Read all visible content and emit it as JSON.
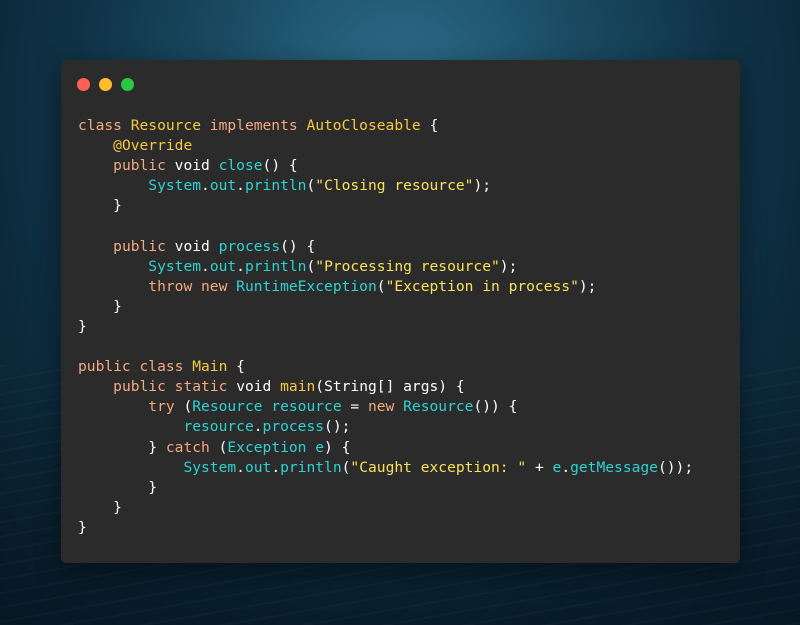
{
  "window": {
    "controls": [
      "close-dot",
      "minimize-dot",
      "maximize-dot"
    ]
  },
  "colors": {
    "keyword": "#f5a97f",
    "type": "#f6c942",
    "identifier": "#2fd3d3",
    "string": "#f9e25b",
    "plain": "#ffffff",
    "editor_bg": "#2b2b2b"
  },
  "code": {
    "language": "Java",
    "lines": [
      [
        {
          "t": "class ",
          "c": "k"
        },
        {
          "t": "Resource ",
          "c": "t"
        },
        {
          "t": "implements ",
          "c": "k"
        },
        {
          "t": "AutoCloseable",
          "c": "t"
        },
        {
          "t": " {",
          "c": "p"
        }
      ],
      [
        {
          "t": "    ",
          "c": "p"
        },
        {
          "t": "@Override",
          "c": "a"
        }
      ],
      [
        {
          "t": "    ",
          "c": "p"
        },
        {
          "t": "public ",
          "c": "k"
        },
        {
          "t": "void ",
          "c": "p"
        },
        {
          "t": "close",
          "c": "f"
        },
        {
          "t": "() {",
          "c": "p"
        }
      ],
      [
        {
          "t": "        ",
          "c": "p"
        },
        {
          "t": "System",
          "c": "f"
        },
        {
          "t": ".",
          "c": "p"
        },
        {
          "t": "out",
          "c": "f"
        },
        {
          "t": ".",
          "c": "p"
        },
        {
          "t": "println",
          "c": "f"
        },
        {
          "t": "(",
          "c": "p"
        },
        {
          "t": "\"Closing resource\"",
          "c": "s"
        },
        {
          "t": ");",
          "c": "p"
        }
      ],
      [
        {
          "t": "    }",
          "c": "p"
        }
      ],
      [],
      [
        {
          "t": "    ",
          "c": "p"
        },
        {
          "t": "public ",
          "c": "k"
        },
        {
          "t": "void ",
          "c": "p"
        },
        {
          "t": "process",
          "c": "f"
        },
        {
          "t": "() {",
          "c": "p"
        }
      ],
      [
        {
          "t": "        ",
          "c": "p"
        },
        {
          "t": "System",
          "c": "f"
        },
        {
          "t": ".",
          "c": "p"
        },
        {
          "t": "out",
          "c": "f"
        },
        {
          "t": ".",
          "c": "p"
        },
        {
          "t": "println",
          "c": "f"
        },
        {
          "t": "(",
          "c": "p"
        },
        {
          "t": "\"Processing resource\"",
          "c": "s"
        },
        {
          "t": ");",
          "c": "p"
        }
      ],
      [
        {
          "t": "        ",
          "c": "p"
        },
        {
          "t": "throw ",
          "c": "k"
        },
        {
          "t": "new ",
          "c": "k"
        },
        {
          "t": "RuntimeException",
          "c": "f"
        },
        {
          "t": "(",
          "c": "p"
        },
        {
          "t": "\"Exception in process\"",
          "c": "s"
        },
        {
          "t": ");",
          "c": "p"
        }
      ],
      [
        {
          "t": "    }",
          "c": "p"
        }
      ],
      [
        {
          "t": "}",
          "c": "p"
        }
      ],
      [],
      [
        {
          "t": "public ",
          "c": "k"
        },
        {
          "t": "class ",
          "c": "k"
        },
        {
          "t": "Main",
          "c": "t"
        },
        {
          "t": " {",
          "c": "p"
        }
      ],
      [
        {
          "t": "    ",
          "c": "p"
        },
        {
          "t": "public ",
          "c": "k"
        },
        {
          "t": "static ",
          "c": "k"
        },
        {
          "t": "void ",
          "c": "p"
        },
        {
          "t": "main",
          "c": "t"
        },
        {
          "t": "(String[] args) {",
          "c": "p"
        }
      ],
      [
        {
          "t": "        ",
          "c": "p"
        },
        {
          "t": "try ",
          "c": "k"
        },
        {
          "t": "(",
          "c": "p"
        },
        {
          "t": "Resource resource",
          "c": "f"
        },
        {
          "t": " = ",
          "c": "p"
        },
        {
          "t": "new ",
          "c": "k"
        },
        {
          "t": "Resource",
          "c": "f"
        },
        {
          "t": "()) {",
          "c": "p"
        }
      ],
      [
        {
          "t": "            ",
          "c": "p"
        },
        {
          "t": "resource",
          "c": "f"
        },
        {
          "t": ".",
          "c": "p"
        },
        {
          "t": "process",
          "c": "f"
        },
        {
          "t": "();",
          "c": "p"
        }
      ],
      [
        {
          "t": "        } ",
          "c": "p"
        },
        {
          "t": "catch ",
          "c": "k"
        },
        {
          "t": "(",
          "c": "p"
        },
        {
          "t": "Exception e",
          "c": "f"
        },
        {
          "t": ") {",
          "c": "p"
        }
      ],
      [
        {
          "t": "            ",
          "c": "p"
        },
        {
          "t": "System",
          "c": "f"
        },
        {
          "t": ".",
          "c": "p"
        },
        {
          "t": "out",
          "c": "f"
        },
        {
          "t": ".",
          "c": "p"
        },
        {
          "t": "println",
          "c": "f"
        },
        {
          "t": "(",
          "c": "p"
        },
        {
          "t": "\"Caught exception: \"",
          "c": "s"
        },
        {
          "t": " + ",
          "c": "p"
        },
        {
          "t": "e",
          "c": "f"
        },
        {
          "t": ".",
          "c": "p"
        },
        {
          "t": "getMessage",
          "c": "f"
        },
        {
          "t": "());",
          "c": "p"
        }
      ],
      [
        {
          "t": "        }",
          "c": "p"
        }
      ],
      [
        {
          "t": "    }",
          "c": "p"
        }
      ],
      [
        {
          "t": "}",
          "c": "p"
        }
      ]
    ]
  }
}
